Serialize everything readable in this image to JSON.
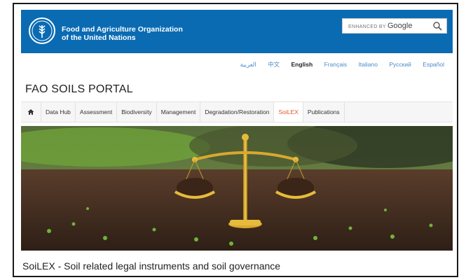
{
  "header": {
    "org_name_line1": "Food and Agriculture Organization",
    "org_name_line2": "of the United Nations",
    "search": {
      "label_small": "ENHANCED BY",
      "label_brand": "Google"
    }
  },
  "languages": [
    "العربية",
    "中文",
    "English",
    "Français",
    "Italiano",
    "Русский",
    "Español"
  ],
  "active_language": "English",
  "portal_title": "FAO SOILS PORTAL",
  "nav": {
    "items": [
      "Data Hub",
      "Assessment",
      "Biodiversity",
      "Management",
      "Degradation/Restoration",
      "SoiLEX",
      "Publications"
    ],
    "active": "SoiLEX"
  },
  "page_title": "SoiLEX - Soil related legal instruments and soil governance",
  "colors": {
    "header_blue": "#0a6bb3",
    "nav_active": "#e0582a",
    "link": "#4a8bc8"
  }
}
